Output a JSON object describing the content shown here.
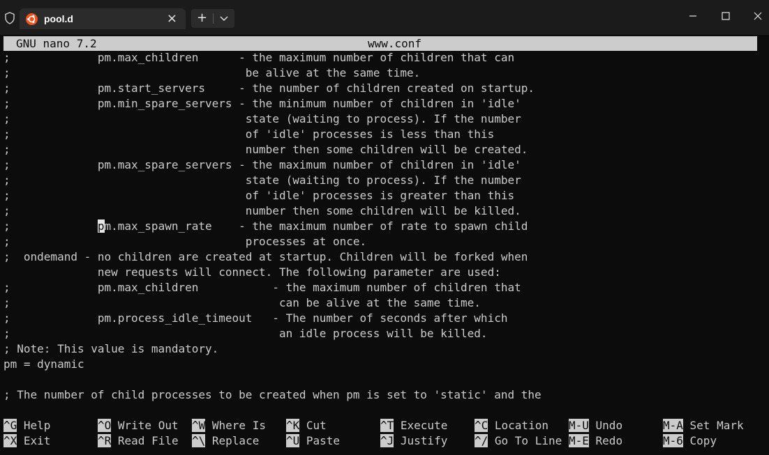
{
  "window": {
    "tab_title": "pool.d",
    "tab_close": "×",
    "new_tab": "+"
  },
  "nano": {
    "version": "GNU nano 7.2",
    "filename": "www.conf"
  },
  "content": {
    "lines": [
      ";             pm.max_children      - the maximum number of children that can",
      ";                                   be alive at the same time.",
      ";             pm.start_servers     - the number of children created on startup.",
      ";             pm.min_spare_servers - the minimum number of children in 'idle'",
      ";                                   state (waiting to process). If the number",
      ";                                   of 'idle' processes is less than this",
      ";                                   number then some children will be created.",
      ";             pm.max_spare_servers - the maximum number of children in 'idle'",
      ";                                   state (waiting to process). If the number",
      ";                                   of 'idle' processes is greater than this",
      ";                                   number then some children will be killed.",
      ";             pm.max_spawn_rate    - the maximum number of rate to spawn child",
      ";                                   processes at once.",
      ";  ondemand - no children are created at startup. Children will be forked when",
      "              new requests will connect. The following parameter are used:",
      ";             pm.max_children           - the maximum number of children that",
      ";                                        can be alive at the same time.",
      ";             pm.process_idle_timeout   - The number of seconds after which",
      ";                                        an idle process will be killed.",
      "; Note: This value is mandatory.",
      "pm = dynamic",
      "",
      "; The number of child processes to be created when pm is set to 'static' and the"
    ],
    "cursor_line": {
      "prefix": ";             ",
      "cursor_char": "p",
      "suffix": "m.max_spawn_rate    - the maximum number of rate to spawn child"
    }
  },
  "shortcuts": [
    {
      "key": "^G",
      "label": " Help"
    },
    {
      "key": "^O",
      "label": " Write Out"
    },
    {
      "key": "^W",
      "label": " Where Is"
    },
    {
      "key": "^K",
      "label": " Cut"
    },
    {
      "key": "^T",
      "label": " Execute"
    },
    {
      "key": "^C",
      "label": " Location"
    },
    {
      "key": "M-U",
      "label": " Undo"
    },
    {
      "key": "M-A",
      "label": " Set Mark"
    },
    {
      "key": "^X",
      "label": " Exit"
    },
    {
      "key": "^R",
      "label": " Read File"
    },
    {
      "key": "^\\",
      "label": " Replace"
    },
    {
      "key": "^U",
      "label": " Paste"
    },
    {
      "key": "^J",
      "label": " Justify"
    },
    {
      "key": "^/",
      "label": " Go To Line"
    },
    {
      "key": "M-E",
      "label": " Redo"
    },
    {
      "key": "M-6",
      "label": " Copy"
    }
  ],
  "colors": {
    "terminal_bg": "#0c0c0c",
    "terminal_fg": "#cccccc",
    "ubuntu_orange": "#e95420"
  }
}
